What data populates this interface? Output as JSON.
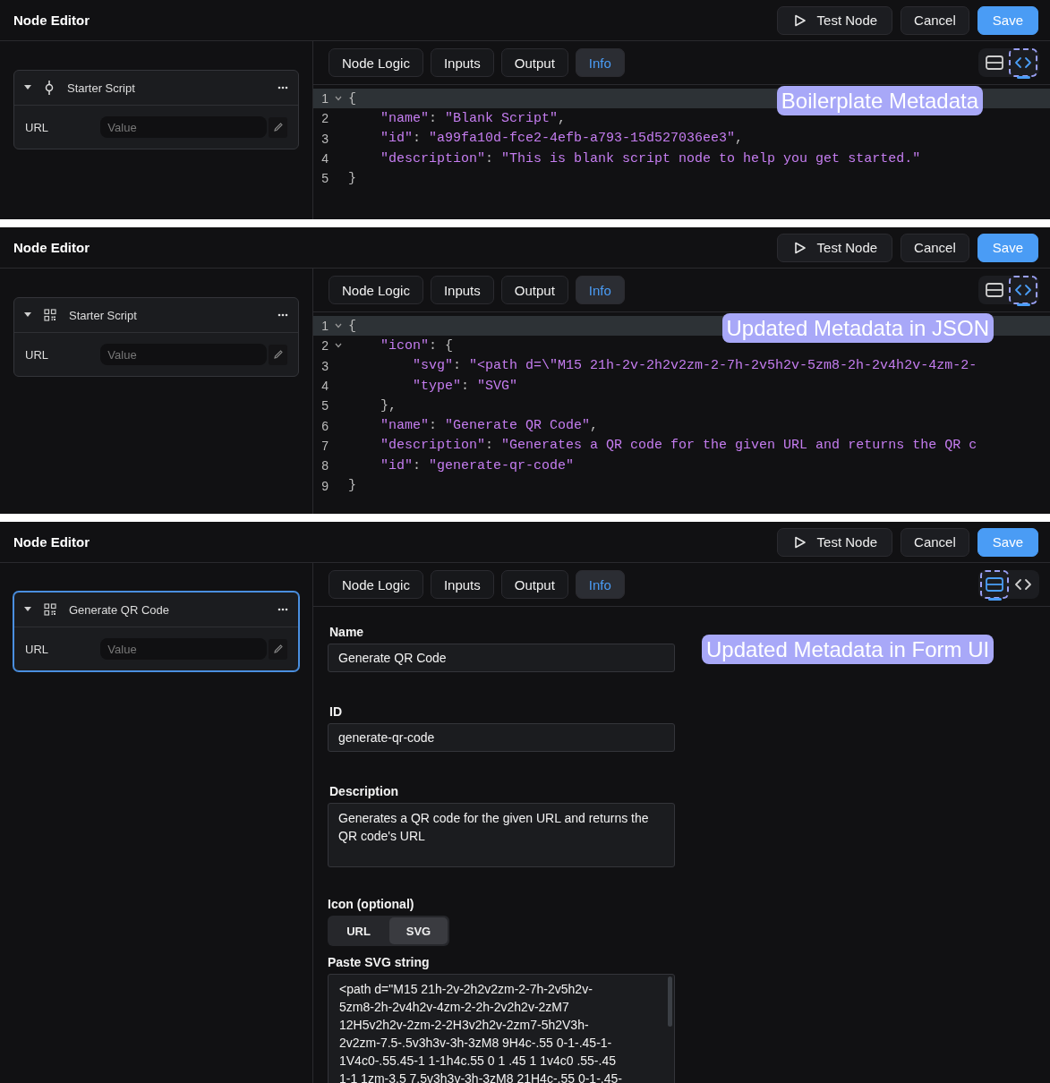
{
  "panels": [
    {
      "title": "Node Editor",
      "buttons": [
        {
          "kind": "test",
          "label": "Test Node"
        },
        {
          "kind": "cancel",
          "label": "Cancel"
        },
        {
          "kind": "save",
          "label": "Save"
        }
      ],
      "node": {
        "title": "Starter Script",
        "kind": "script",
        "selected": false,
        "field_label": "URL",
        "field_placeholder": "Value"
      },
      "tabs": [
        {
          "label": "Node Logic",
          "selected": false
        },
        {
          "label": "Inputs",
          "selected": false
        },
        {
          "label": "Output",
          "selected": false
        },
        {
          "label": "Info",
          "selected": true
        }
      ],
      "view_toggle": [
        {
          "kind": "form",
          "selected": false,
          "highlighted": false
        },
        {
          "kind": "code",
          "selected": true,
          "highlighted": true
        }
      ],
      "callout": "Boilerplate Metadata",
      "content": {
        "kind": "code",
        "lines": [
          {
            "number": "1",
            "fold": true,
            "active": true,
            "text": "{"
          },
          {
            "number": "2",
            "fold": false,
            "active": false,
            "text": "    \"name\": \"Blank Script\","
          },
          {
            "number": "3",
            "fold": false,
            "active": false,
            "text": "    \"id\": \"a99fa10d-fce2-4efb-a793-15d527036ee3\","
          },
          {
            "number": "4",
            "fold": false,
            "active": false,
            "text": "    \"description\": \"This is blank script node to help you get started.\""
          },
          {
            "number": "5",
            "fold": false,
            "active": false,
            "text": "}"
          }
        ]
      }
    },
    {
      "title": "Node Editor",
      "buttons": [
        {
          "kind": "test",
          "label": "Test Node"
        },
        {
          "kind": "cancel",
          "label": "Cancel"
        },
        {
          "kind": "save",
          "label": "Save"
        }
      ],
      "node": {
        "title": "Starter Script",
        "kind": "qr",
        "selected": false,
        "field_label": "URL",
        "field_placeholder": "Value"
      },
      "tabs": [
        {
          "label": "Node Logic",
          "selected": false
        },
        {
          "label": "Inputs",
          "selected": false
        },
        {
          "label": "Output",
          "selected": false
        },
        {
          "label": "Info",
          "selected": true
        }
      ],
      "view_toggle": [
        {
          "kind": "form",
          "selected": false,
          "highlighted": false
        },
        {
          "kind": "code",
          "selected": true,
          "highlighted": true
        }
      ],
      "callout": "Updated Metadata in JSON",
      "content": {
        "kind": "code",
        "lines": [
          {
            "number": "1",
            "fold": true,
            "active": true,
            "text": "{"
          },
          {
            "number": "2",
            "fold": true,
            "active": false,
            "text": "    \"icon\": {"
          },
          {
            "number": "3",
            "fold": false,
            "active": false,
            "text": "        \"svg\": \"<path d=\\\"M15 21h-2v-2h2v2zm-2-7h-2v5h2v-5zm8-2h-2v4h2v-4zm-2-"
          },
          {
            "number": "4",
            "fold": false,
            "active": false,
            "text": "        \"type\": \"SVG\""
          },
          {
            "number": "5",
            "fold": false,
            "active": false,
            "text": "    },"
          },
          {
            "number": "6",
            "fold": false,
            "active": false,
            "text": "    \"name\": \"Generate QR Code\","
          },
          {
            "number": "7",
            "fold": false,
            "active": false,
            "text": "    \"description\": \"Generates a QR code for the given URL and returns the QR c"
          },
          {
            "number": "8",
            "fold": false,
            "active": false,
            "text": "    \"id\": \"generate-qr-code\""
          },
          {
            "number": "9",
            "fold": false,
            "active": false,
            "text": "}"
          }
        ]
      }
    },
    {
      "title": "Node Editor",
      "buttons": [
        {
          "kind": "test",
          "label": "Test Node"
        },
        {
          "kind": "cancel",
          "label": "Cancel"
        },
        {
          "kind": "save",
          "label": "Save"
        }
      ],
      "node": {
        "title": "Generate QR Code",
        "kind": "qr",
        "selected": true,
        "field_label": "URL",
        "field_placeholder": "Value"
      },
      "tabs": [
        {
          "label": "Node Logic",
          "selected": false
        },
        {
          "label": "Inputs",
          "selected": false
        },
        {
          "label": "Output",
          "selected": false
        },
        {
          "label": "Info",
          "selected": true
        }
      ],
      "view_toggle": [
        {
          "kind": "form",
          "selected": true,
          "highlighted": true
        },
        {
          "kind": "code",
          "selected": false,
          "highlighted": false
        }
      ],
      "callout": "Updated Metadata in Form UI",
      "content": {
        "kind": "form",
        "name_label": "Name",
        "name_value": "Generate QR Code",
        "id_label": "ID",
        "id_value": "generate-qr-code",
        "description_label": "Description",
        "description_value": "Generates a QR code for the given URL and returns the QR code's URL",
        "icon_label": "Icon (optional)",
        "icon_options": [
          {
            "label": "URL",
            "selected": false
          },
          {
            "label": "SVG",
            "selected": true
          }
        ],
        "svg_label": "Paste SVG string",
        "svg_lines": [
          "<path d=\"M15 21h-2v-2h2v2zm-2-7h-2v5h2v-",
          "5zm8-2h-2v4h2v-4zm-2-2h-2v2h2v-2zM7",
          "12H5v2h2v-2zm-2-2H3v2h2v-2zm7-5h2V3h-",
          "2v2zm-7.5-.5v3h3v-3h-3zM8 9H4c-.55 0-1-.45-1-",
          "1V4c0-.55.45-1 1-1h4c.55 0 1 .45 1 1v4c0 .55-.45",
          "1-1 1zm-3.5 7.5v3h3v-3h-3zM8 21H4c-.55 0-1-.45-"
        ]
      }
    }
  ]
}
